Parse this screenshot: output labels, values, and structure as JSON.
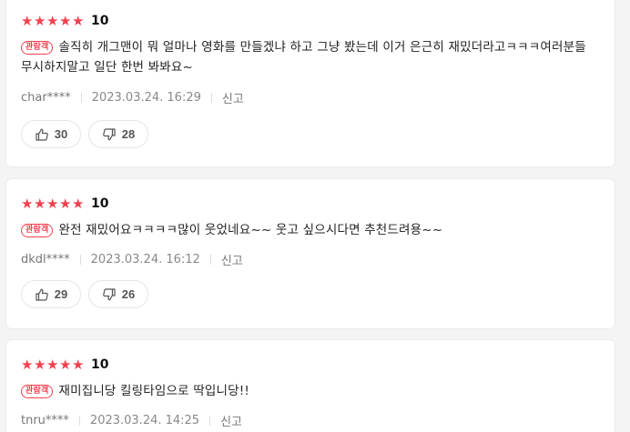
{
  "reviews": [
    {
      "stars": [
        "★",
        "★",
        "★",
        "★",
        "★"
      ],
      "score": "10",
      "badge": "관람객",
      "text": "솔직히 개그맨이 뭐 얼마나 영화를 만들겠냐 하고 그냥 봤는데 이거 은근히 재밌더라고ㅋㅋㅋ여러분들 무시하지말고 일단 한번 봐봐요~",
      "author": "char****",
      "date": "2023.03.24. 16:29",
      "report": "신고",
      "likes": "30",
      "dislikes": "28"
    },
    {
      "stars": [
        "★",
        "★",
        "★",
        "★",
        "★"
      ],
      "score": "10",
      "badge": "관람객",
      "text": "완전 재밌어요ㅋㅋㅋㅋ많이 웃었네요~~ 웃고 싶으시다면 추천드려용~~",
      "author": "dkdl****",
      "date": "2023.03.24. 16:12",
      "report": "신고",
      "likes": "29",
      "dislikes": "26"
    },
    {
      "stars": [
        "★",
        "★",
        "★",
        "★",
        "★"
      ],
      "score": "10",
      "badge": "관람객",
      "text": "재미집니당 킬링타임으로 딱입니당!!",
      "author": "tnru****",
      "date": "2023.03.24. 14:25",
      "report": "신고"
    }
  ],
  "colors": {
    "star": "#f2414e",
    "badge": "#f2414e",
    "background": "#f4f4f5"
  },
  "icons": {
    "like": "thumbs-up-icon",
    "dislike": "thumbs-down-icon"
  }
}
